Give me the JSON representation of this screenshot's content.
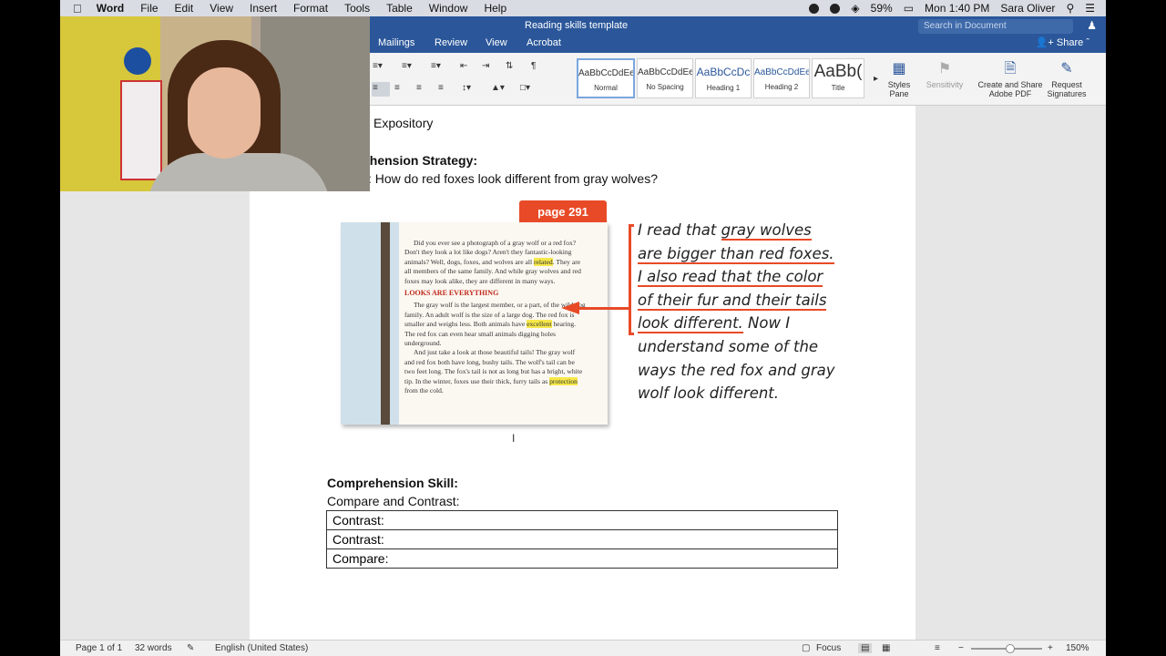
{
  "menubar": {
    "items": [
      "Word",
      "File",
      "Edit",
      "View",
      "Insert",
      "Format",
      "Tools",
      "Table",
      "Window",
      "Help"
    ],
    "battery": "59%",
    "clock": "Mon 1:40 PM",
    "user": "Sara Oliver"
  },
  "titlebar": {
    "doc_title": "Reading skills template",
    "search_placeholder": "Search in Document"
  },
  "tabs": {
    "items": [
      "Mailings",
      "Review",
      "View",
      "Acrobat"
    ],
    "share": "Share"
  },
  "ribbon": {
    "styles": [
      {
        "preview": "AaBbCcDdEe",
        "name": "Normal"
      },
      {
        "preview": "AaBbCcDdEe",
        "name": "No Spacing"
      },
      {
        "preview": "AaBbCcDc",
        "name": "Heading 1"
      },
      {
        "preview": "AaBbCcDdEe",
        "name": "Heading 2"
      },
      {
        "preview": "AaBb(",
        "name": "Title"
      }
    ],
    "styles_pane": "Styles\nPane",
    "sensitivity": "Sensitivity",
    "create_share": "Create and Share\nAdobe PDF",
    "request_signatures": "Request\nSignatures"
  },
  "document": {
    "genre": "Expository",
    "strategy_heading": "ehension Strategy:",
    "strategy_question": ": How do red foxes look different from gray wolves?",
    "page_tag": "page 291",
    "book": {
      "p1a": "Did you ever see a photograph of a gray wolf or a red fox? Don't they look a lot like dogs? Aren't they fantastic-looking animals? Well, dogs, foxes, and wolves are all ",
      "p1_hl": "related",
      "p1b": ". They are all members of the same family. And while gray wolves and red foxes may look alike, they are different in many ways.",
      "heading": "LOOKS ARE EVERYTHING",
      "p2a": "The gray wolf is the largest member, or a part, of the wild dog family. An adult wolf is the size of a large dog. The red fox is smaller and weighs less. Both animals have ",
      "p2_hl": "excellent",
      "p2b": " hearing. The red fox can even hear small animals digging holes underground.",
      "p3a": "And just take a look at those beautiful tails! The gray wolf and red fox both have long, bushy tails. The wolf's tail can be two feet long. The fox's tail is not as long but has a bright, white tip. In the winter, foxes use their thick, furry tails as ",
      "p3_hl": "protection",
      "p3b": " from the cold."
    },
    "note": {
      "l1a": "I read that ",
      "l1b": "gray wolves",
      "l2": "are bigger than red foxes.",
      "l3": "I also read that the color",
      "l4": "of their fur and their tails",
      "l5a": "look different.",
      "l5b": " Now I",
      "l6": "understand some of the",
      "l7": "ways the red fox and gray",
      "l8": "wolf look different."
    },
    "skill_heading": "Comprehension Skill:",
    "skill_subheading": "Compare and Contrast:",
    "table_rows": [
      "Contrast:",
      "Contrast:",
      "Compare:"
    ]
  },
  "statusbar": {
    "page": "Page 1 of 1",
    "words": "32 words",
    "language": "English (United States)",
    "focus": "Focus",
    "zoom": "150%"
  }
}
